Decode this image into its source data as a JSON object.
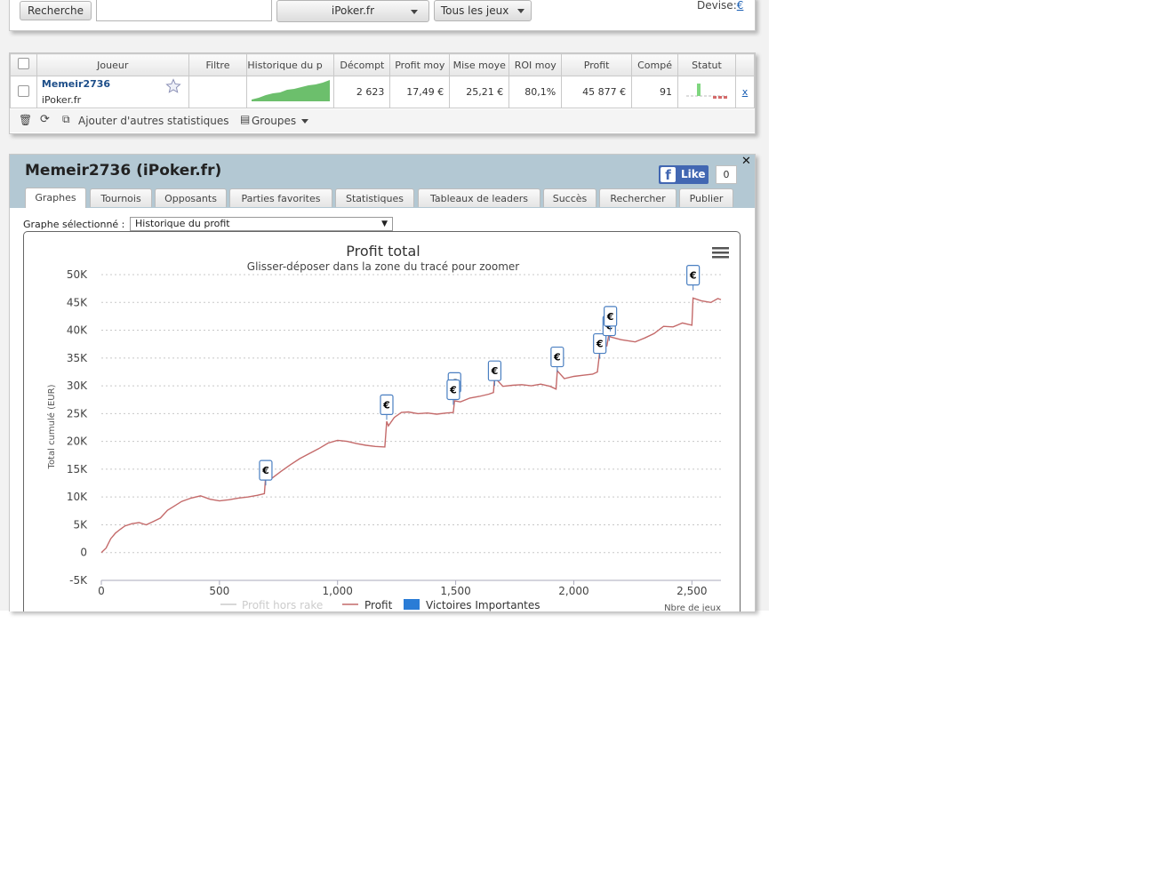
{
  "toolbar": {
    "search_label": "Recherche",
    "search_value": "",
    "site_select": "iPoker.fr",
    "games_select": "Tous les jeux",
    "currency_label": "Devise:",
    "currency_value": "€"
  },
  "players_table": {
    "columns": [
      "Joueur",
      "Filtre",
      "Historique du p",
      "Décompt",
      "Profit moy",
      "Mise moye",
      "ROI moy",
      "Profit",
      "Compé",
      "Statut"
    ],
    "rows": [
      {
        "player": "Memeir2736",
        "site": "iPoker.fr",
        "filter": "",
        "count": "2 623",
        "avg_profit": "17,49 €",
        "avg_stake": "25,21 €",
        "avg_roi": "80,1%",
        "profit": "45 877 €",
        "comp": "91",
        "remove": "x"
      }
    ],
    "footer": {
      "add_stats": "Ajouter d'autres statistiques",
      "groups": "Groupes"
    }
  },
  "profile": {
    "title": "Memeir2736 (iPoker.fr)",
    "fb_like": "Like",
    "fb_count": "0",
    "tabs": [
      "Graphes",
      "Tournois",
      "Opposants",
      "Parties favorites",
      "Statistiques",
      "Tableaux de leaders",
      "Succès",
      "Rechercher",
      "Publier"
    ],
    "graph_label": "Graphe sélectionné :",
    "graph_select": "Historique du profit"
  },
  "colors": {
    "profit_line": "#c46a6a",
    "rake_line": "#cccccc",
    "marker_border": "#4a7fc1",
    "header_bar": "#b3c8d3",
    "sparkline": "#6cbf6c"
  },
  "chart_data": {
    "type": "line",
    "title": "Profit total",
    "subtitle": "Glisser-déposer dans la zone du tracé pour zoomer",
    "ylabel": "Total cumulé (EUR)",
    "xlabel": "Nbre de jeux",
    "xlim": [
      0,
      2623
    ],
    "ylim": [
      -5000,
      50000
    ],
    "xticks": [
      "0",
      "500",
      "1,000",
      "1,500",
      "2,000",
      "2,500"
    ],
    "xtick_values": [
      0,
      500,
      1000,
      1500,
      2000,
      2500
    ],
    "yticks": [
      "-5K",
      "0",
      "5K",
      "10K",
      "15K",
      "20K",
      "25K",
      "30K",
      "35K",
      "40K",
      "45K",
      "50K"
    ],
    "ytick_values": [
      -5000,
      0,
      5000,
      10000,
      15000,
      20000,
      25000,
      30000,
      35000,
      40000,
      45000,
      50000
    ],
    "grid": true,
    "legend_position": "bottom",
    "legend": [
      "Profit hors rake",
      "Profit",
      "Victoires Importantes"
    ],
    "series": [
      {
        "name": "Profit",
        "x": [
          0,
          20,
          40,
          60,
          80,
          100,
          130,
          160,
          190,
          220,
          250,
          280,
          310,
          340,
          380,
          420,
          460,
          500,
          540,
          580,
          620,
          660,
          690,
          696,
          720,
          760,
          800,
          840,
          880,
          920,
          960,
          1000,
          1040,
          1080,
          1120,
          1160,
          1200,
          1208,
          1215,
          1240,
          1270,
          1300,
          1340,
          1380,
          1420,
          1460,
          1490,
          1495,
          1520,
          1560,
          1600,
          1640,
          1660,
          1665,
          1700,
          1740,
          1780,
          1820,
          1860,
          1900,
          1925,
          1930,
          1960,
          2000,
          2040,
          2080,
          2100,
          2110,
          2130,
          2140,
          2150,
          2155,
          2200,
          2260,
          2300,
          2340,
          2380,
          2420,
          2460,
          2500,
          2505,
          2540,
          2580,
          2610,
          2623
        ],
        "y": [
          0,
          800,
          2500,
          3500,
          4200,
          4800,
          5200,
          5400,
          5000,
          5600,
          6200,
          7600,
          8400,
          9200,
          9800,
          10200,
          9600,
          9300,
          9500,
          9800,
          10000,
          10300,
          10600,
          13800,
          13300,
          14600,
          15800,
          16900,
          17800,
          18700,
          19700,
          20200,
          20000,
          19600,
          19300,
          19100,
          19000,
          23600,
          22800,
          24300,
          25200,
          25300,
          25000,
          25100,
          24900,
          25100,
          25200,
          27300,
          27100,
          27800,
          28100,
          28500,
          28800,
          31500,
          29900,
          30100,
          30200,
          30000,
          30300,
          29900,
          29400,
          32700,
          31300,
          31700,
          31900,
          32100,
          32500,
          36200,
          36900,
          37200,
          39600,
          38800,
          38300,
          37900,
          38600,
          39400,
          40700,
          40600,
          41300,
          40900,
          45800,
          45300,
          45000,
          45700,
          45500
        ]
      },
      {
        "name": "Victoires Importantes",
        "x": [
          696,
          1208,
          1495,
          1490,
          1665,
          1930,
          2110,
          2150,
          2155,
          2505
        ],
        "y": [
          14800,
          26600,
          30600,
          29300,
          32700,
          35200,
          37600,
          40800,
          42500,
          49900
        ],
        "label": "€"
      }
    ]
  }
}
